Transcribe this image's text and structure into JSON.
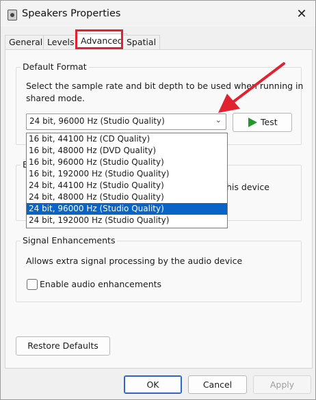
{
  "window": {
    "title": "Speakers Properties",
    "close_glyph": "✕"
  },
  "tabs": [
    {
      "label": "General",
      "active": false
    },
    {
      "label": "Levels",
      "active": false
    },
    {
      "label": "Advanced",
      "active": true
    },
    {
      "label": "Spatial sound",
      "active": false
    }
  ],
  "default_format": {
    "group_label": "Default Format",
    "description_line1": "Select the sample rate and bit depth to be used when running in",
    "description_line2": "shared mode.",
    "selected_value": "24 bit, 96000 Hz (Studio Quality)",
    "options": [
      "16 bit, 44100 Hz (CD Quality)",
      "16 bit, 48000 Hz (DVD Quality)",
      "16 bit, 96000 Hz (Studio Quality)",
      "16 bit, 192000 Hz (Studio Quality)",
      "24 bit, 44100 Hz (Studio Quality)",
      "24 bit, 48000 Hz (Studio Quality)",
      "24 bit, 96000 Hz (Studio Quality)",
      "24 bit, 192000 Hz (Studio Quality)"
    ],
    "selected_index": 6,
    "test_label": "Test"
  },
  "exclusive_mode": {
    "partial_group_label": "E",
    "partial_text": "his device"
  },
  "signal_enhancements": {
    "group_label": "Signal Enhancements",
    "description": "Allows extra signal processing by the audio device",
    "checkbox_label": "Enable audio enhancements",
    "checked": false
  },
  "buttons": {
    "restore_defaults": "Restore Defaults",
    "ok": "OK",
    "cancel": "Cancel",
    "apply": "Apply"
  },
  "annotation": {
    "highlight_color": "#e0232f",
    "arrow_color": "#e0232f"
  }
}
